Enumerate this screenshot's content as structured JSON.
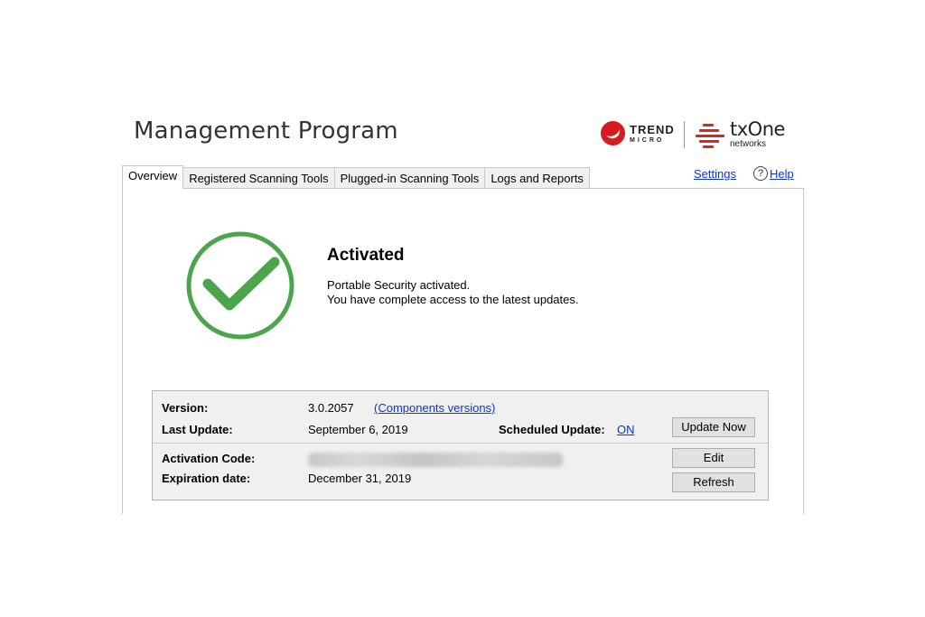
{
  "app": {
    "title": "Management Program"
  },
  "logos": {
    "trend_top": "TREND",
    "trend_bottom": "MICRO",
    "txone_top": "txOne",
    "txone_bottom": "networks"
  },
  "tabs": [
    {
      "label": "Overview",
      "active": true
    },
    {
      "label": "Registered Scanning Tools",
      "active": false
    },
    {
      "label": "Plugged-in Scanning Tools",
      "active": false
    },
    {
      "label": "Logs and Reports",
      "active": false
    }
  ],
  "header_links": {
    "settings": "Settings",
    "help": "Help",
    "help_glyph": "?"
  },
  "status": {
    "title": "Activated",
    "line1": "Portable Security activated.",
    "line2": "You have complete access to the latest updates.",
    "icon": "check-circle-icon",
    "color": "#4ca54c"
  },
  "info": {
    "version_label": "Version:",
    "version_value": "3.0.2057",
    "components_link": "(Components versions)",
    "last_update_label": "Last Update:",
    "last_update_value": "September 6, 2019",
    "scheduled_label": "Scheduled Update:",
    "scheduled_value": "ON",
    "update_now_button": "Update Now",
    "activation_label": "Activation Code:",
    "edit_button": "Edit",
    "expiration_label": "Expiration date:",
    "expiration_value": "December 31, 2019",
    "refresh_button": "Refresh"
  },
  "colors": {
    "link": "#0a36c8",
    "brand_red": "#d71920",
    "check_green": "#4ca54c"
  }
}
